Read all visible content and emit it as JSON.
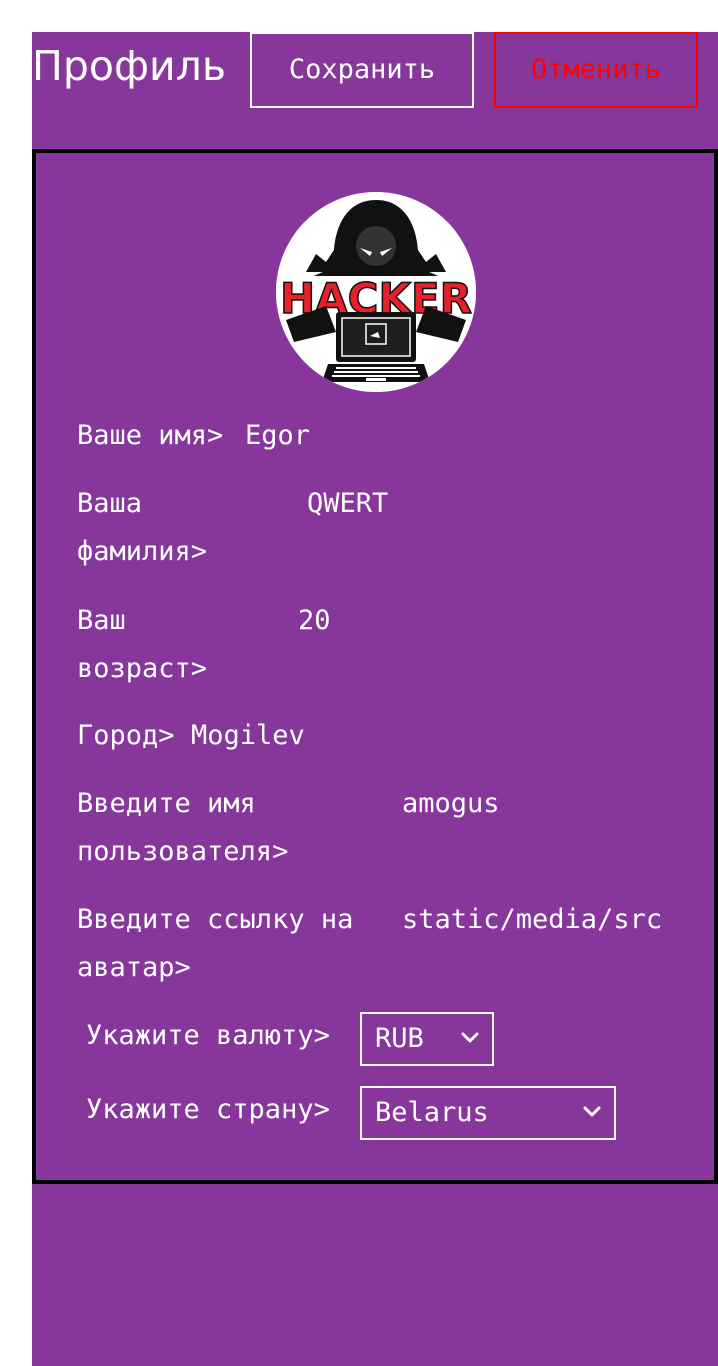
{
  "header": {
    "title": "Профиль",
    "save_label": "Сохранить",
    "cancel_label": "Отменить"
  },
  "avatar": {
    "logo_text": "HACKER",
    "icon": "hacker-logo-icon"
  },
  "fields": [
    {
      "label_line1": "Ваше имя>",
      "label_line2": "",
      "value": "Egor"
    },
    {
      "label_line1": "Ваша",
      "label_line2": "фамилия>",
      "value": "QWERT"
    },
    {
      "label_line1": "Ваш",
      "label_line2": "возраст>",
      "value": "20"
    },
    {
      "label_line1": "Город>",
      "label_line2": "",
      "value": "Mogilev"
    },
    {
      "label_line1": "Введите имя",
      "label_line2": "пользователя>",
      "value": "amogus"
    },
    {
      "label_line1": "Введите ссылку на",
      "label_line2": "аватар>",
      "value": "static/media/src"
    }
  ],
  "currency": {
    "label": "Укажите валюту>",
    "selected": "RUB"
  },
  "country": {
    "label": "Укажите страну>",
    "selected": "Belarus"
  },
  "colors": {
    "panel": "#87379c",
    "text": "#ffffff",
    "cancel": "#ff0000",
    "card_border": "#000000",
    "logo_red": "#e8202a"
  },
  "icons": {
    "select_chevron": "chevron-down-icon"
  }
}
